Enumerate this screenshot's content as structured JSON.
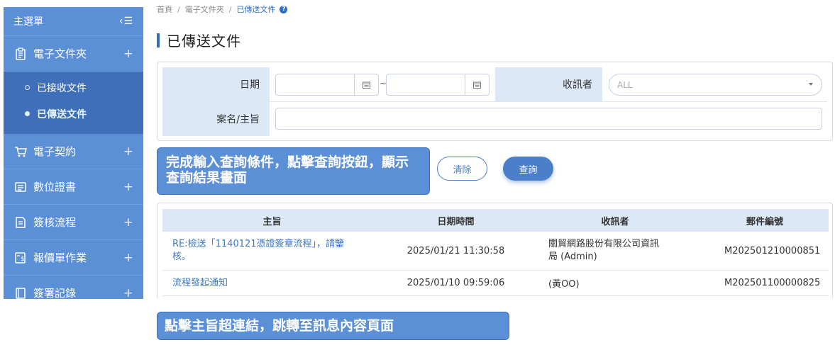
{
  "sidebar": {
    "header": "主選單",
    "toggle_icon": "collapse-menu-icon",
    "items": [
      {
        "label": "電子文件夾",
        "icon": "clipboard-icon"
      },
      {
        "label": "電子契約",
        "icon": "cart-icon"
      },
      {
        "label": "數位證書",
        "icon": "certificate-icon"
      },
      {
        "label": "簽核流程",
        "icon": "approval-icon"
      },
      {
        "label": "報價單作業",
        "icon": "quote-icon"
      },
      {
        "label": "簽署記錄",
        "icon": "book-icon"
      }
    ],
    "sub_items": [
      {
        "label": "已接收文件",
        "active": false
      },
      {
        "label": "已傳送文件",
        "active": true
      }
    ]
  },
  "breadcrumb": {
    "home": "首頁",
    "level1": "電子文件夾",
    "current": "已傳送文件"
  },
  "page": {
    "title": "已傳送文件"
  },
  "form": {
    "date_label": "日期",
    "date_separator": "~",
    "date_from": "",
    "date_to": "",
    "recipient_label": "收訊者",
    "recipient_value": "ALL",
    "subject_label": "案名/主旨",
    "subject_value": ""
  },
  "buttons": {
    "clear": "清除",
    "search": "查詢"
  },
  "callouts": {
    "search_hint": "完成輸入查詢條件，點擊查詢按鈕，顯示查詢結果畫面",
    "link_hint": "點擊主旨超連結，跳轉至訊息內容頁面"
  },
  "table": {
    "columns": [
      "主旨",
      "日期時間",
      "收訊者",
      "郵件編號"
    ],
    "rows": [
      {
        "subject": "RE:檢送「1140121憑證簽章流程」，請鑒核。",
        "datetime": "2025/01/21 11:30:58",
        "recipient": "關貿網路股份有限公司資訊局 (Admin)",
        "mail_no": "M202501210000851"
      },
      {
        "subject": "流程發起通知",
        "datetime": "2025/01/10 09:59:06",
        "recipient": "(黃OO)",
        "mail_no": "M202501100000825"
      }
    ]
  },
  "colors": {
    "sidebar": "#5b8fd6",
    "sidebar_active": "#3f6fb8",
    "accent": "#4b7fc9",
    "label_bg": "#dde8f7"
  }
}
